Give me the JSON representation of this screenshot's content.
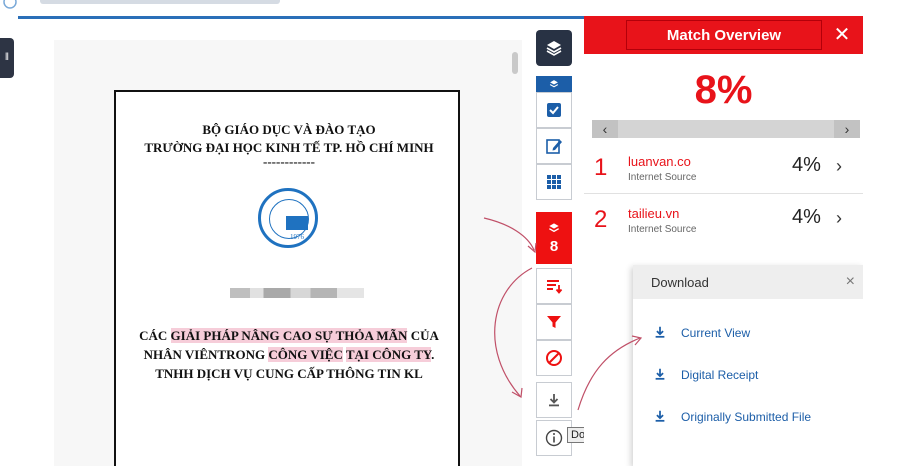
{
  "document": {
    "line1": "BỘ GIÁO DỤC VÀ ĐÀO TẠO",
    "line2": "TRƯỜNG ĐẠI HỌC KINH TẾ TP. HỒ CHÍ MINH",
    "separator": "------------",
    "emblem_year": "1976",
    "title_parts": {
      "p1": "CÁC ",
      "p2": "GIẢI PHÁP NÂNG CAO SỰ THỎA MÃN",
      "p3": " CỦA",
      "p4": "NHÂN VIÊNTRONG ",
      "p5": "CÔNG VIỆC",
      "p6": " ",
      "p7": "TẠI CÔNG TY",
      "p8": ".",
      "p9": "TNHH DỊCH VỤ CUNG CẤP THÔNG TIN KL"
    }
  },
  "toolbar": {
    "match_count": "8",
    "download_tooltip": "Download"
  },
  "match_overview": {
    "title": "Match Overview",
    "percent": "8%",
    "matches": [
      {
        "rank": "1",
        "source": "luanvan.co",
        "type": "Internet Source",
        "percent": "4%"
      },
      {
        "rank": "2",
        "source": "tailieu.vn",
        "type": "Internet Source",
        "percent": "4%"
      }
    ]
  },
  "download": {
    "title": "Download",
    "close": "×",
    "items": [
      {
        "label": "Current View"
      },
      {
        "label": "Digital Receipt"
      },
      {
        "label": "Originally Submitted File"
      }
    ]
  },
  "colors": {
    "accent_red": "#e8131a",
    "brand_blue": "#1c5ea8",
    "dark": "#283244"
  }
}
